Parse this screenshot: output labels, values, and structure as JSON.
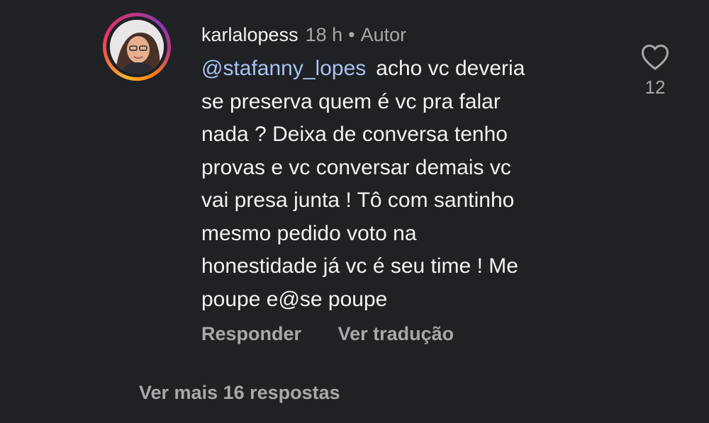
{
  "comment": {
    "username": "karlalopess",
    "time": "18 h",
    "separator": "•",
    "role": "Autor",
    "mention": "@stafanny_lopes",
    "text": "acho vc deveria\nse preserva quem é vc pra falar\nnada ? Deixa de conversa tenho\nprovas e vc conversar demais vc\nvai presa junta ! Tô com santinho\nmesmo pedido voto na\nhonestidade já vc é seu time ! Me\npoupe e@se poupe",
    "avatar_icon": "profile-photo"
  },
  "actions": {
    "reply": "Responder",
    "translate": "Ver tradução"
  },
  "like": {
    "icon": "heart-outline-icon",
    "count": "12"
  },
  "replies": {
    "more_label": "Ver mais 16 respostas"
  },
  "colors": {
    "background": "#1f2125",
    "text": "#f2f2f2",
    "muted": "#a8a8a8",
    "mention": "#a7c3f0"
  }
}
